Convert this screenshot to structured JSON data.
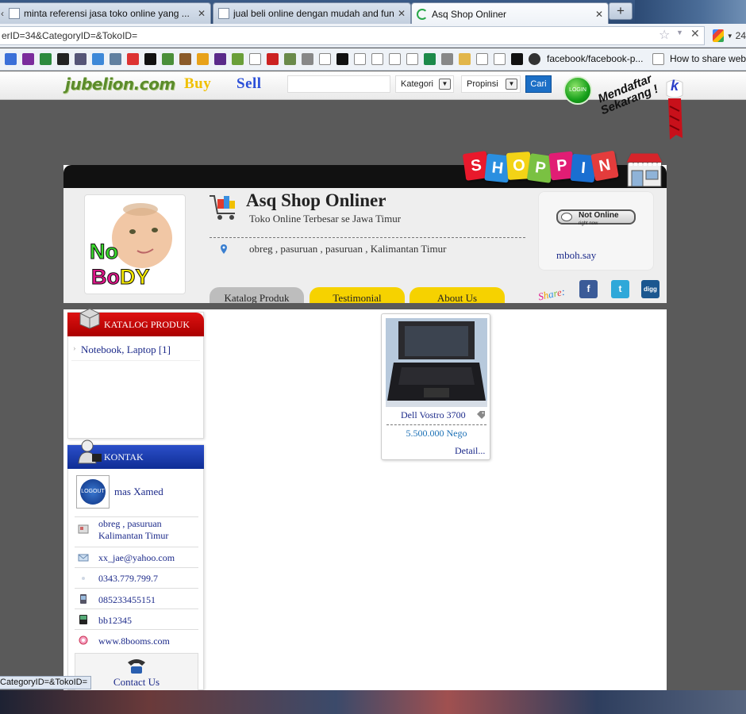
{
  "browser": {
    "tabs": [
      {
        "title": "minta referensi jasa toko online yang ...",
        "active": false
      },
      {
        "title": "jual beli online dengan mudah and fun",
        "active": false
      },
      {
        "title": "Asq Shop Onliner",
        "active": true
      }
    ],
    "url": "erID=34&CategoryID=&TokoID=",
    "search_engine_text": "24",
    "bookmarks": [
      {
        "label": "facebook/facebook-p..."
      },
      {
        "label": "How to share web"
      }
    ],
    "status_url": "CategoryID=&TokoID="
  },
  "site": {
    "logo": "jubelion.com",
    "buy_label": "Buy",
    "sell_label": "Sell",
    "search_value": "",
    "kategori_label": "Kategori",
    "propinsi_label": "Propinsi",
    "cari_label": "Cari",
    "login_label": "LOGIN",
    "register_label_1": "Mendaftar",
    "register_label_2": "Sekarang !",
    "kaskus_letter": "k"
  },
  "shop": {
    "banner_letters": [
      "S",
      "H",
      "O",
      "P",
      "P",
      "I",
      "N"
    ],
    "banner_colors": [
      "#e8192c",
      "#2a8fe0",
      "#f3d316",
      "#7ac142",
      "#e11d74",
      "#1a6fd1",
      "#e43c3c"
    ],
    "avatar_text_1": "No",
    "avatar_text_2": "Bo",
    "avatar_text_3": "DY",
    "name": "Asq Shop Onliner",
    "tagline": "Toko Online Terbesar se Jawa Timur",
    "location": "obreg , pasuruan , pasuruan , Kalimantan Timur",
    "status_title": "Not Online",
    "status_sub": "right now",
    "status_user": "mboh.say",
    "tabs": [
      {
        "label": "Katalog Produk",
        "color": "#bdbdbd"
      },
      {
        "label": "Testimonial",
        "color": "#f6d200"
      },
      {
        "label": "About Us",
        "color": "#f6d200"
      }
    ],
    "share_label": "Share:",
    "social": [
      {
        "icon": "facebook-icon",
        "glyph": "f",
        "color": "#3b5b98"
      },
      {
        "icon": "twitter-icon",
        "glyph": "t",
        "color": "#2fa8d9"
      },
      {
        "icon": "digg-icon",
        "glyph": "digg",
        "color": "#1b5790"
      }
    ]
  },
  "sidebar": {
    "catalog_title": "KATALOG PRODUK",
    "catalog_items": [
      {
        "label": "Notebook, Laptop [1]"
      }
    ],
    "contact_title": "KONTAK",
    "seller_logo_text": "LOGOUT",
    "seller_name": "mas Xamed",
    "contacts": [
      {
        "icon": "address-icon",
        "line1": "obreg , pasuruan",
        "line2": "Kalimantan Timur"
      },
      {
        "icon": "email-icon",
        "line1": "xx_jae@yahoo.com",
        "line2": ""
      },
      {
        "icon": "phone-icon",
        "line1": "0343.779.799.7",
        "line2": ""
      },
      {
        "icon": "mobile-icon",
        "line1": "085233455151",
        "line2": ""
      },
      {
        "icon": "blackberry-icon",
        "line1": "bb12345",
        "line2": ""
      },
      {
        "icon": "website-icon",
        "line1": "www.8booms.com",
        "line2": ""
      }
    ],
    "contact_us_label": "Contact Us"
  },
  "product": {
    "name": "Dell Vostro 3700",
    "price": "5.500.000 Nego",
    "detail_label": "Detail..."
  }
}
